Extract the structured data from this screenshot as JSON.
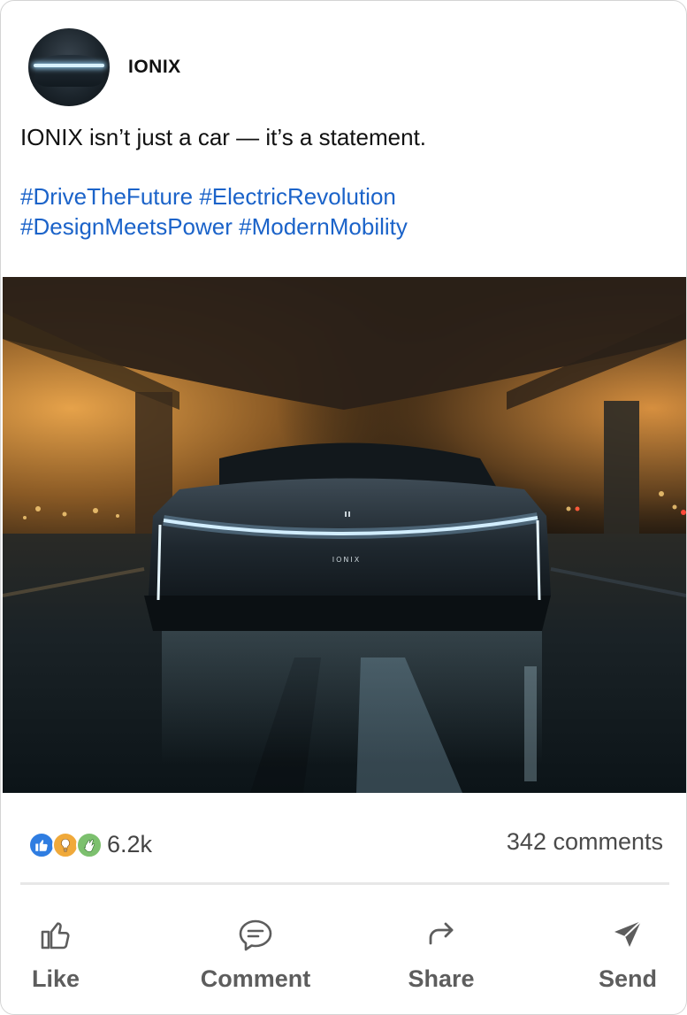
{
  "post": {
    "author": "IONIX",
    "text": "IONIX isn’t just a car — it’s a statement.",
    "hashtags": [
      "#DriveTheFuture",
      "#ElectricRevolution",
      "#DesignMeetsPower",
      "#ModernMobility"
    ],
    "image_badge": "IONIX"
  },
  "stats": {
    "reaction_icons": [
      "like-icon",
      "idea-icon",
      "clap-icon"
    ],
    "reactions_count": "6.2k",
    "comments": "342 comments"
  },
  "actions": {
    "like": "Like",
    "comment": "Comment",
    "share": "Share",
    "send": "Send"
  },
  "colors": {
    "hashtag": "#1b63c9",
    "like_reaction": "#2f7de1",
    "idea_reaction": "#f0a93a",
    "clap_reaction": "#7cc06e",
    "action_text": "#5d5d5d"
  }
}
